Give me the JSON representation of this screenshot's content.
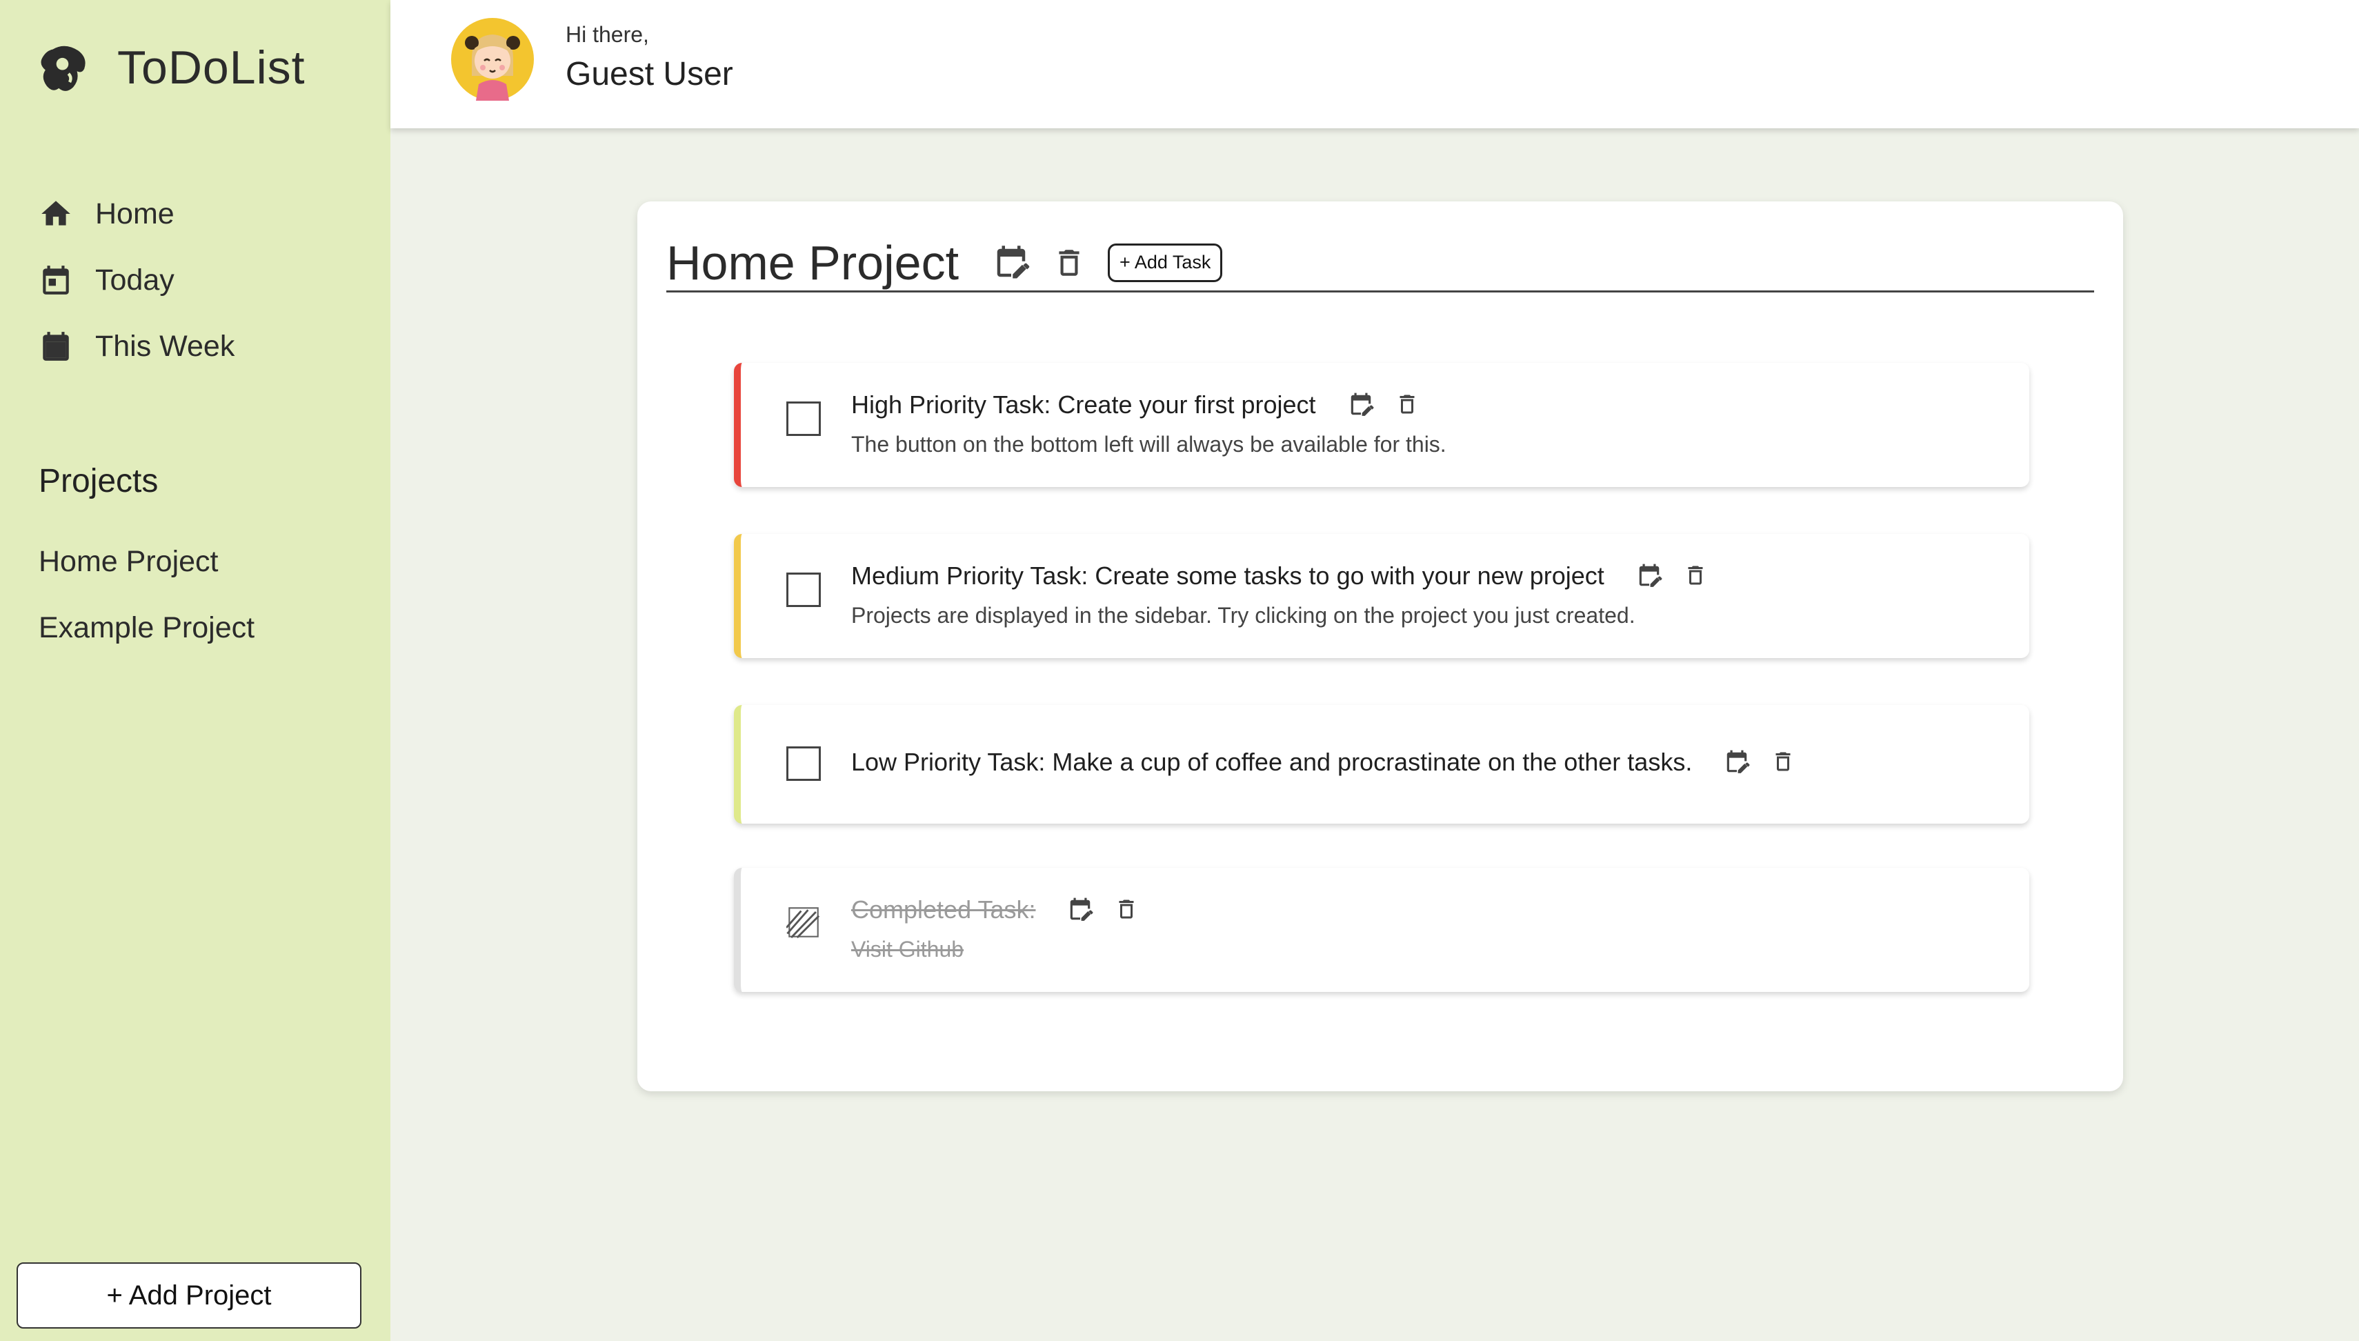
{
  "app": {
    "name": "ToDoList"
  },
  "nav": [
    {
      "label": "Home",
      "icon": "home-icon"
    },
    {
      "label": "Today",
      "icon": "calendar-today-icon"
    },
    {
      "label": "This Week",
      "icon": "calendar-week-icon"
    }
  ],
  "projects": {
    "heading": "Projects",
    "items": [
      "Home Project",
      "Example Project"
    ],
    "add_label": "+ Add Project"
  },
  "header": {
    "greeting": "Hi there,",
    "user": "Guest User"
  },
  "project": {
    "title": "Home Project",
    "add_task_label": "+ Add Task",
    "tasks": [
      {
        "title": "High Priority Task: Create your first project",
        "description": "The button on the bottom left will always be available for this.",
        "priority": "high",
        "completed": false
      },
      {
        "title": "Medium Priority Task: Create some tasks to go with your new project",
        "description": "Projects are displayed in the sidebar. Try clicking on the project you just created.",
        "priority": "medium",
        "completed": false
      },
      {
        "title": "Low Priority Task: Make a cup of coffee and procrastinate on the other tasks.",
        "description": "",
        "priority": "low",
        "completed": false
      },
      {
        "title": "Completed Task:",
        "description": "Visit Github",
        "priority": "none",
        "completed": true
      }
    ]
  },
  "colors": {
    "sidebar": "#e2edbd",
    "background": "#eff2e9",
    "high": "#e8453c",
    "medium": "#f2c94c",
    "low": "#dfe98a"
  }
}
